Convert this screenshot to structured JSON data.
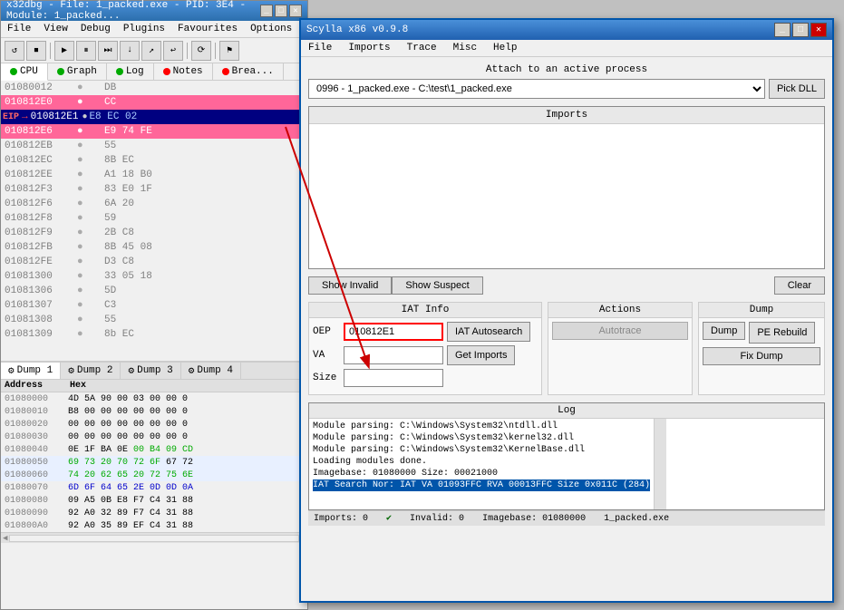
{
  "x32dbg": {
    "title": "x32dbg - File: 1_packed.exe - PID: 3E4 - Module: 1_packed...",
    "menu": [
      "File",
      "View",
      "Debug",
      "Plugins",
      "Favourites",
      "Options",
      "Help"
    ],
    "tabs": [
      {
        "label": "CPU",
        "color": "#00aa00",
        "active": true
      },
      {
        "label": "Graph",
        "color": "#00aa00",
        "active": false
      },
      {
        "label": "Log",
        "color": "#00aa00",
        "active": false
      },
      {
        "label": "Notes",
        "color": "#ff0000",
        "active": false
      },
      {
        "label": "Brea...",
        "color": "#ff0000",
        "active": false
      }
    ],
    "disasm": [
      {
        "addr": "01080012DB",
        "dot": true,
        "bytes": "DB",
        "instr": ""
      },
      {
        "addr": "010812E0",
        "dot": true,
        "bytes": "CC",
        "instr": "",
        "eip": false,
        "highlight": true
      },
      {
        "addr": "010812E1",
        "dot": true,
        "bytes": "E8 EC 02",
        "instr": "",
        "eip": true
      },
      {
        "addr": "010812E6",
        "dot": true,
        "bytes": "E9 74 FE",
        "instr": "",
        "highlight": true
      },
      {
        "addr": "010812EB",
        "dot": true,
        "bytes": "55",
        "instr": ""
      },
      {
        "addr": "010812EC",
        "dot": true,
        "bytes": "8B EC",
        "instr": ""
      },
      {
        "addr": "010812EE",
        "dot": true,
        "bytes": "A1 18 B0",
        "instr": ""
      },
      {
        "addr": "010812F3",
        "dot": true,
        "bytes": "83 E0 1F",
        "instr": ""
      },
      {
        "addr": "010812F6",
        "dot": true,
        "bytes": "6A 20",
        "instr": ""
      },
      {
        "addr": "010812F8",
        "dot": true,
        "bytes": "59",
        "instr": ""
      },
      {
        "addr": "010812F9",
        "dot": true,
        "bytes": "2B C8",
        "instr": ""
      },
      {
        "addr": "010812FB",
        "dot": true,
        "bytes": "8B 45 08",
        "instr": ""
      },
      {
        "addr": "010812FE",
        "dot": true,
        "bytes": "D3 C8",
        "instr": ""
      },
      {
        "addr": "01081300",
        "dot": true,
        "bytes": "33 05 18",
        "instr": ""
      },
      {
        "addr": "01081306",
        "dot": true,
        "bytes": "5D",
        "instr": ""
      },
      {
        "addr": "01081307",
        "dot": true,
        "bytes": "C3",
        "instr": ""
      },
      {
        "addr": "01081308",
        "dot": true,
        "bytes": "55",
        "instr": ""
      },
      {
        "addr": "01081309",
        "dot": true,
        "bytes": "8b EC",
        "instr": ""
      }
    ],
    "dump_tabs": [
      "Dump 1",
      "Dump 2",
      "Dump 3",
      "Dump 4"
    ],
    "dump_header": [
      "Address",
      "Hex",
      ""
    ],
    "dump_rows": [
      {
        "addr": "01080000",
        "bytes": "4D 5A 90 00 03 00 00 0",
        "ascii": ""
      },
      {
        "addr": "01080010",
        "bytes": "B8 00 00 00 00 00 00 0",
        "ascii": ""
      },
      {
        "addr": "01080020",
        "bytes": "00 00 00 00 00 00 00 0",
        "ascii": ""
      },
      {
        "addr": "01080030",
        "bytes": "00 00 00 00 00 00 00 0",
        "ascii": ""
      },
      {
        "addr": "01080040",
        "bytes": "0E 1F BA 0E 00 B4 09 CD",
        "ascii": ""
      },
      {
        "addr": "01080050",
        "bytes": "69 73 20 70 72 6F 67 72",
        "ascii": "",
        "highlight": true
      },
      {
        "addr": "01080060",
        "bytes": "74 20 62 65 20 72 75 6E",
        "ascii": "",
        "highlight": true
      },
      {
        "addr": "01080070",
        "bytes": "6D 6F 64 65 2E 0D 0D 0A",
        "ascii": "",
        "highlight": true
      },
      {
        "addr": "01080080",
        "bytes": "09 A5 0B E8 F7 C4 31 88",
        "ascii": ""
      },
      {
        "addr": "01080090",
        "bytes": "92 A0 32 89 F7 C4 31 88",
        "ascii": ""
      },
      {
        "addr": "010800A0",
        "bytes": "92 A0 35 89 EF C4 31 88",
        "ascii": ""
      }
    ]
  },
  "scylla": {
    "title": "Scylla x86 v0.9.8",
    "menu": [
      "File",
      "Imports",
      "Trace",
      "Misc",
      "Help"
    ],
    "attach_label": "Attach to an active process",
    "attach_value": "0996 - 1_packed.exe - C:\\test\\1_packed.exe",
    "pick_dll_label": "Pick DLL",
    "imports_label": "Imports",
    "show_invalid_label": "Show Invalid",
    "show_suspect_label": "Show Suspect",
    "clear_label": "Clear",
    "iat_info_label": "IAT Info",
    "oep_label": "OEP",
    "oep_value": "010812E1",
    "va_label": "VA",
    "size_label": "Size",
    "iat_autosearch_label": "IAT Autosearch",
    "get_imports_label": "Get Imports",
    "actions_label": "Actions",
    "autotrace_label": "Autotrace",
    "dump_label": "Dump",
    "dump_btn_label": "Dump",
    "pe_rebuild_label": "PE Rebuild",
    "fix_dump_label": "Fix Dump",
    "log_label": "Log",
    "log_entries": [
      {
        "text": "Module parsing: C:\\Windows\\System32\\ntdll.dll",
        "highlight": false
      },
      {
        "text": "Module parsing: C:\\Windows\\System32\\kernel32.dll",
        "highlight": false
      },
      {
        "text": "Module parsing: C:\\Windows\\System32\\KernelBase.dll",
        "highlight": false
      },
      {
        "text": "Loading modules done.",
        "highlight": false
      },
      {
        "text": "Imagebase: 01080000 Size: 00021000",
        "highlight": false
      },
      {
        "text": "IAT Search Nor: IAT VA 01093FFC RVA 00013FFC Size 0x011C (284)",
        "highlight": true
      }
    ],
    "status_imports": "Imports: 0",
    "status_invalid": "Invalid: 0",
    "status_imagebase": "Imagebase: 01080000",
    "status_module": "1_packed.exe"
  }
}
